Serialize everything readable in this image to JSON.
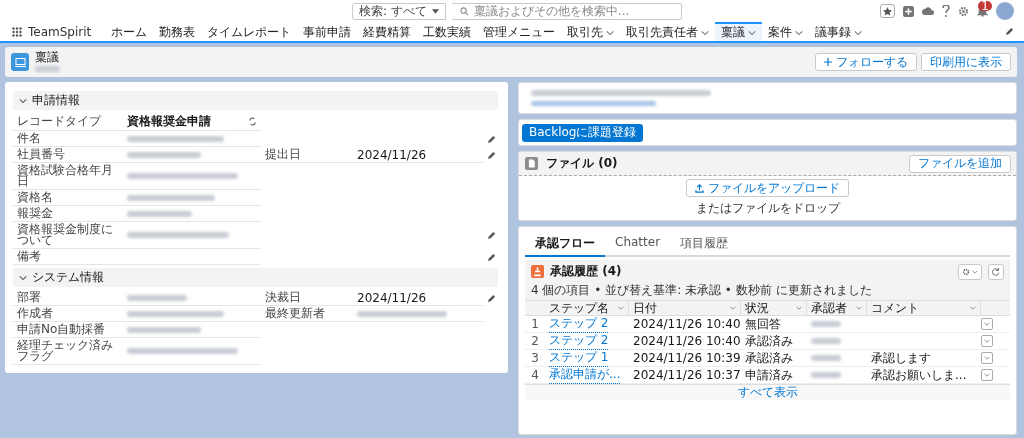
{
  "header": {
    "search_scope": "検索: すべて",
    "search_placeholder": "稟議およびその他を検索中...",
    "notification_count": "1"
  },
  "nav": {
    "app_name": "TeamSpirit",
    "items": [
      {
        "label": "ホーム",
        "dropdown": false,
        "selected": false
      },
      {
        "label": "勤務表",
        "dropdown": false,
        "selected": false
      },
      {
        "label": "タイムレポート",
        "dropdown": false,
        "selected": false
      },
      {
        "label": "事前申請",
        "dropdown": false,
        "selected": false
      },
      {
        "label": "経費精算",
        "dropdown": false,
        "selected": false
      },
      {
        "label": "工数実績",
        "dropdown": false,
        "selected": false
      },
      {
        "label": "管理メニュー",
        "dropdown": false,
        "selected": false
      },
      {
        "label": "取引先",
        "dropdown": true,
        "selected": false
      },
      {
        "label": "取引先責任者",
        "dropdown": true,
        "selected": false
      },
      {
        "label": "稟議",
        "dropdown": true,
        "selected": true
      },
      {
        "label": "案件",
        "dropdown": true,
        "selected": false
      },
      {
        "label": "議事録",
        "dropdown": true,
        "selected": false
      }
    ]
  },
  "record": {
    "object_label": "稟議",
    "follow_button": "フォローする",
    "print_button": "印刷用に表示"
  },
  "sections": [
    {
      "title": "申請情報",
      "expanded": true,
      "rows": [
        {
          "label": "レコードタイプ",
          "value": "資格報奨金申請",
          "kind": "recordtype",
          "editable": false
        },
        {
          "label": "件名",
          "kind": "redacted",
          "editable": true
        },
        {
          "label": "社員番号",
          "kind": "redacted",
          "editable": true,
          "right": {
            "label": "提出日",
            "value": "2024/11/26"
          }
        },
        {
          "label": "資格試験合格年月日",
          "kind": "redacted",
          "editable": false
        },
        {
          "label": "資格名",
          "kind": "redacted",
          "editable": false
        },
        {
          "label": "報奨金",
          "kind": "redacted",
          "editable": false
        },
        {
          "label": "資格報奨金制度について",
          "kind": "redacted",
          "editable": true
        },
        {
          "label": "備考",
          "kind": "empty",
          "editable": true
        }
      ]
    },
    {
      "title": "システム情報",
      "expanded": true,
      "rows": [
        {
          "label": "部署",
          "kind": "redacted",
          "editable": true,
          "right": {
            "label": "決裁日",
            "value": "2024/11/26"
          }
        },
        {
          "label": "作成者",
          "kind": "redacted",
          "editable": false,
          "right": {
            "label": "最終更新者"
          }
        },
        {
          "label": "申請No自動採番",
          "kind": "redacted",
          "editable": false
        },
        {
          "label": "経理チェック済みフラグ",
          "kind": "redacted",
          "editable": false
        }
      ]
    }
  ],
  "backlog_button": "Backlogに課題登録",
  "files": {
    "title": "ファイル (0)",
    "add_button": "ファイルを追加",
    "upload_button": "ファイルをアップロード",
    "drop_hint": "またはファイルをドロップ"
  },
  "related_tabs": [
    {
      "label": "承認フロー",
      "selected": true
    },
    {
      "label": "Chatter",
      "selected": false
    },
    {
      "label": "項目履歴",
      "selected": false
    }
  ],
  "approval": {
    "title": "承認履歴 (4)",
    "summary": "4 個の項目 • 並び替え基準: 未承認 • 数秒前 に更新されました",
    "columns": [
      "ステップ名",
      "日付",
      "状況",
      "承認者",
      "コメント"
    ],
    "rows": [
      {
        "num": "1",
        "step": "ステップ 2",
        "date": "2024/11/26 10:40",
        "status": "無回答",
        "comment": ""
      },
      {
        "num": "2",
        "step": "ステップ 2",
        "date": "2024/11/26 10:40",
        "status": "承認済み",
        "comment": ""
      },
      {
        "num": "3",
        "step": "ステップ 1",
        "date": "2024/11/26 10:39",
        "status": "承認済み",
        "comment": "承認します"
      },
      {
        "num": "4",
        "step": "承認申請が...",
        "date": "2024/11/26 10:37",
        "status": "申請済み",
        "comment": "承認お願いしま..."
      }
    ],
    "view_all": "すべて表示"
  }
}
